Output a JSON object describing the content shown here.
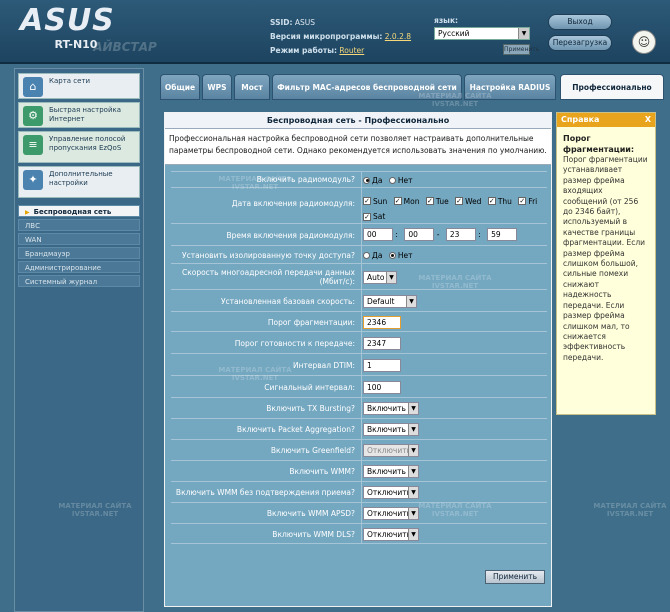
{
  "header": {
    "brand": "ASUS",
    "model": "RT-N10",
    "ssid_label": "SSID:",
    "ssid_value": "ASUS",
    "firmware_label": "Версия микропрограммы:",
    "firmware_value": "2.0.2.8",
    "mode_label": "Режим работы:",
    "mode_value": "Router",
    "language_label": "язык:",
    "language_value": "Русский",
    "apply_small": "Применить",
    "logout": "Выход",
    "reboot": "Перезагрузка"
  },
  "sidebar": {
    "main_items": [
      {
        "label": "Карта сети",
        "icon": "network-map-icon"
      },
      {
        "label": "Быстрая настройка Интернет",
        "icon": "quick-setup-icon"
      },
      {
        "label": "Управление полосой пропускания EzQoS",
        "icon": "qos-icon"
      },
      {
        "label": "Дополнительные настройки",
        "icon": "advanced-settings-icon"
      }
    ],
    "sub_items": [
      {
        "label": "Беспроводная сеть",
        "active": true
      },
      {
        "label": "ЛВС",
        "active": false
      },
      {
        "label": "WAN",
        "active": false
      },
      {
        "label": "Брандмауэр",
        "active": false
      },
      {
        "label": "Администрирование",
        "active": false
      },
      {
        "label": "Системный журнал",
        "active": false
      }
    ]
  },
  "tabs": [
    {
      "label": "Общие"
    },
    {
      "label": "WPS"
    },
    {
      "label": "Мост"
    },
    {
      "label": "Фильтр MAC-адресов беспроводной сети"
    },
    {
      "label": "Настройка RADIUS"
    },
    {
      "label": "Профессионально"
    }
  ],
  "panel": {
    "title": "Беспроводная сеть - Профессионально",
    "description": "Профессиональная настройка беспроводной сети позволяет настраивать дополнительные параметры беспроводной сети. Однако рекомендуется использовать значения по умолчанию.",
    "fields": {
      "radio_enable": {
        "label": "Включить радиомодуль?",
        "yes": "Да",
        "no": "Нет"
      },
      "radio_dates": {
        "label": "Дата включения радиомодуля:",
        "days": [
          "Sun",
          "Mon",
          "Tue",
          "Wed",
          "Thu",
          "Fri",
          "Sat"
        ]
      },
      "radio_time": {
        "label": "Время включения радиомодуля:",
        "from_h": "00",
        "from_m": "00",
        "to_h": "23",
        "to_m": "59"
      },
      "isolated_ap": {
        "label": "Установить изолированную точку доступа?",
        "yes": "Да",
        "no": "Нет"
      },
      "multicast_rate": {
        "label": "Скорость многоадресной передачи данных (Мбит/с):",
        "value": "Auto"
      },
      "basic_rate": {
        "label": "Установленная базовая скорость:",
        "value": "Default"
      },
      "frag_threshold": {
        "label": "Порог фрагментации:",
        "value": "2346"
      },
      "rts_threshold": {
        "label": "Порог готовности к передаче:",
        "value": "2347"
      },
      "dtim": {
        "label": "Интервал DTIM:",
        "value": "1"
      },
      "beacon": {
        "label": "Сигнальный интервал:",
        "value": "100"
      },
      "tx_bursting": {
        "label": "Включить TX Bursting?",
        "value": "Включить"
      },
      "packet_agg": {
        "label": "Включить Packet Aggregation?",
        "value": "Включить"
      },
      "greenfield": {
        "label": "Включить Greenfield?",
        "value": "Отключить"
      },
      "wmm": {
        "label": "Включить WMM?",
        "value": "Включить"
      },
      "wmm_noack": {
        "label": "Включить WMM без подтверждения приема?",
        "value": "Отключить"
      },
      "wmm_apsd": {
        "label": "Включить WMM APSD?",
        "value": "Отключить"
      },
      "wmm_dls": {
        "label": "Включить WMM DLS?",
        "value": "Отключить"
      }
    },
    "apply_label": "Применить"
  },
  "help": {
    "header": "Справка",
    "close": "X",
    "title": "Порог фрагментации:",
    "body": "Порог фрагментации устанавливает размер фрейма входящих сообщений (от 256 до 2346 байт), используемый в качестве границы фрагментации. Если размер фрейма слишком большой, сильные помехи снижают надежность передачи. Если размер фрейма слишком мал, то снижается эффективность передачи."
  },
  "watermark": {
    "brand": "АЙВСТАР",
    "text1": "МАТЕРИАЛ САЙТА",
    "text2": "IVSTAR.NET"
  }
}
